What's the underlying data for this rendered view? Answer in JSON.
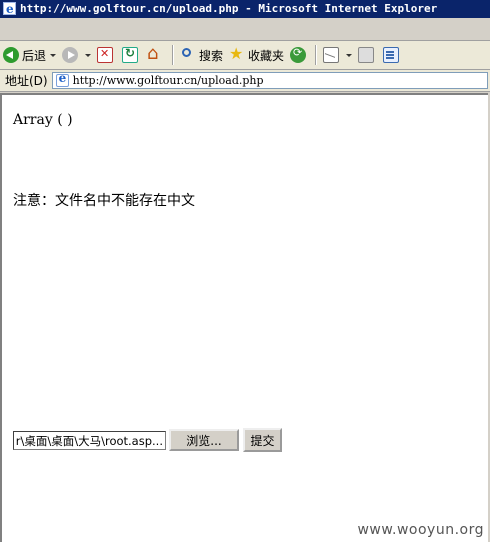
{
  "window": {
    "title": "http://www.golftour.cn/upload.php - Microsoft Internet Explorer"
  },
  "toolbar": {
    "back_label": "后退",
    "search_label": "搜索",
    "favorites_label": "收藏夹"
  },
  "address": {
    "label": "地址(D)",
    "url": "http://www.golftour.cn/upload.php"
  },
  "page": {
    "array_text": "Array ( )",
    "notice": "注意：文件名中不能存在中文",
    "file_value": "...r\\桌面\\桌面\\大马\\root.asp",
    "browse_label": "浏览...",
    "submit_label": "提交"
  },
  "watermark": "www.wooyun.org",
  "colors": {
    "titlebar": "#0a246a",
    "chrome": "#d4d0c8",
    "content_bg": "#ffffff"
  },
  "icons": [
    "ie-icon",
    "back-icon",
    "forward-icon",
    "stop-icon",
    "refresh-icon",
    "home-icon",
    "search-icon",
    "favorites-icon",
    "media-icon",
    "mail-icon",
    "print-icon",
    "edit-icon",
    "page-icon"
  ]
}
